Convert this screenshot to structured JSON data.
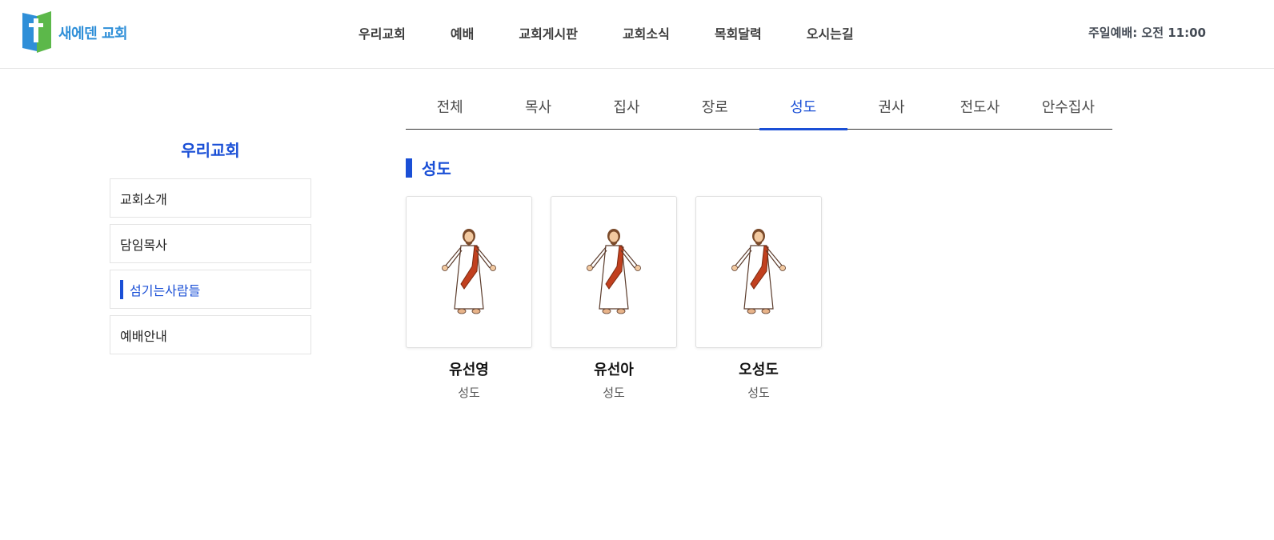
{
  "header": {
    "logo_text": "새에덴 교회",
    "nav": [
      "우리교회",
      "예배",
      "교회게시판",
      "교회소식",
      "목회달력",
      "오시는길"
    ],
    "service_time": "주일예배: 오전 11:00"
  },
  "sidebar": {
    "title": "우리교회",
    "items": [
      {
        "label": "교회소개"
      },
      {
        "label": "담임목사"
      },
      {
        "label": "섬기는사람들"
      },
      {
        "label": "예배안내"
      }
    ],
    "active_index": 2
  },
  "tabs": {
    "items": [
      "전체",
      "목사",
      "집사",
      "장로",
      "성도",
      "권사",
      "전도사",
      "안수집사"
    ],
    "active_index": 4
  },
  "section": {
    "title": "성도"
  },
  "members": [
    {
      "name": "유선영",
      "role": "성도",
      "icon": "jesus-figure-icon"
    },
    {
      "name": "유선아",
      "role": "성도",
      "icon": "jesus-figure-icon"
    },
    {
      "name": "오성도",
      "role": "성도",
      "icon": "jesus-figure-icon"
    }
  ],
  "colors": {
    "accent": "#1a4fd6",
    "logo_blue": "#2f8fd8",
    "logo_green": "#5cb84a"
  }
}
